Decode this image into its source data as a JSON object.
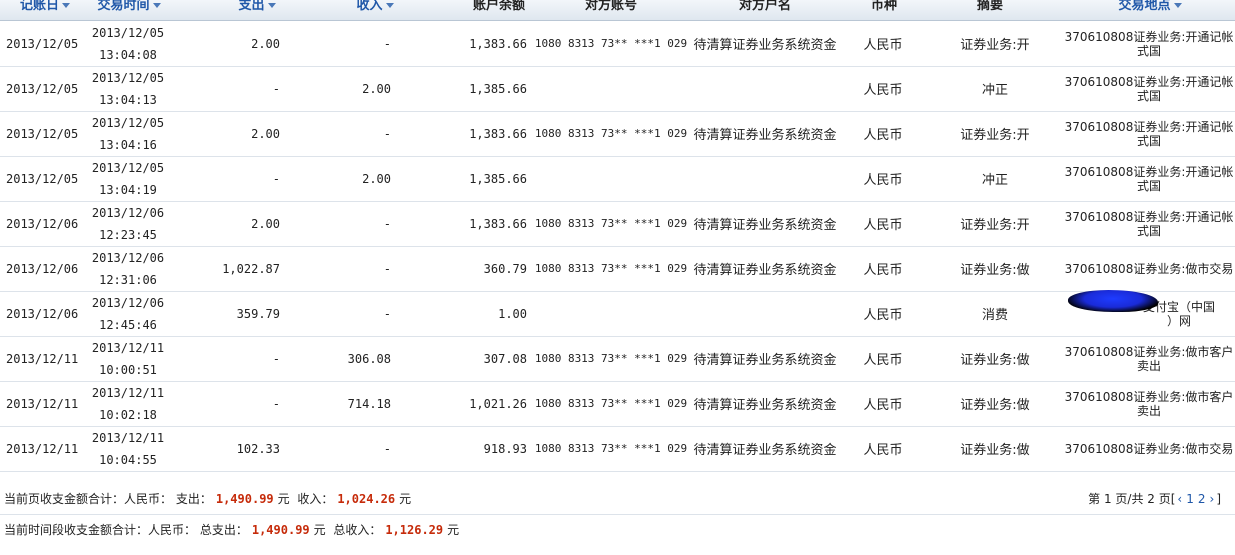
{
  "headers": {
    "record_date": "记账日",
    "trade_time": "交易时间",
    "expense": "支出",
    "income": "收入",
    "balance": "账户余额",
    "counter_account": "对方账号",
    "counter_name": "对方户名",
    "currency": "币种",
    "summary": "摘要",
    "location": "交易地点"
  },
  "rows": [
    {
      "date": "2013/12/05",
      "time_date": "2013/12/05",
      "time_clock": "13:04:08",
      "expense": "2.00",
      "income": "-",
      "balance": "1,383.66",
      "account": "1080 8313 73** ***1 029",
      "name": "待清算证券业务系统资金",
      "currency": "人民币",
      "summary": "证券业务:开",
      "loc1": "370610808证券业务:开通记帐",
      "loc2": "式国"
    },
    {
      "date": "2013/12/05",
      "time_date": "2013/12/05",
      "time_clock": "13:04:13",
      "expense": "-",
      "income": "2.00",
      "balance": "1,385.66",
      "account": "",
      "name": "",
      "currency": "人民币",
      "summary": "冲正",
      "loc1": "370610808证券业务:开通记帐",
      "loc2": "式国"
    },
    {
      "date": "2013/12/05",
      "time_date": "2013/12/05",
      "time_clock": "13:04:16",
      "expense": "2.00",
      "income": "-",
      "balance": "1,383.66",
      "account": "1080 8313 73** ***1 029",
      "name": "待清算证券业务系统资金",
      "currency": "人民币",
      "summary": "证券业务:开",
      "loc1": "370610808证券业务:开通记帐",
      "loc2": "式国"
    },
    {
      "date": "2013/12/05",
      "time_date": "2013/12/05",
      "time_clock": "13:04:19",
      "expense": "-",
      "income": "2.00",
      "balance": "1,385.66",
      "account": "",
      "name": "",
      "currency": "人民币",
      "summary": "冲正",
      "loc1": "370610808证券业务:开通记帐",
      "loc2": "式国"
    },
    {
      "date": "2013/12/06",
      "time_date": "2013/12/06",
      "time_clock": "12:23:45",
      "expense": "2.00",
      "income": "-",
      "balance": "1,383.66",
      "account": "1080 8313 73** ***1 029",
      "name": "待清算证券业务系统资金",
      "currency": "人民币",
      "summary": "证券业务:开",
      "loc1": "370610808证券业务:开通记帐",
      "loc2": "式国"
    },
    {
      "date": "2013/12/06",
      "time_date": "2013/12/06",
      "time_clock": "12:31:06",
      "expense": "1,022.87",
      "income": "-",
      "balance": "360.79",
      "account": "1080 8313 73** ***1 029",
      "name": "待清算证券业务系统资金",
      "currency": "人民币",
      "summary": "证券业务:做",
      "loc1": "370610808证券业务:做市交易",
      "loc2": ""
    },
    {
      "date": "2013/12/06",
      "time_date": "2013/12/06",
      "time_clock": "12:45:46",
      "expense": "359.79",
      "income": "-",
      "balance": "1.00",
      "account": "",
      "name": "",
      "currency": "人民币",
      "summary": "消费",
      "loc1": "支付宝（中国",
      "loc2": "）网"
    },
    {
      "date": "2013/12/11",
      "time_date": "2013/12/11",
      "time_clock": "10:00:51",
      "expense": "-",
      "income": "306.08",
      "balance": "307.08",
      "account": "1080 8313 73** ***1 029",
      "name": "待清算证券业务系统资金",
      "currency": "人民币",
      "summary": "证券业务:做",
      "loc1": "370610808证券业务:做市客户",
      "loc2": "卖出"
    },
    {
      "date": "2013/12/11",
      "time_date": "2013/12/11",
      "time_clock": "10:02:18",
      "expense": "-",
      "income": "714.18",
      "balance": "1,021.26",
      "account": "1080 8313 73** ***1 029",
      "name": "待清算证券业务系统资金",
      "currency": "人民币",
      "summary": "证券业务:做",
      "loc1": "370610808证券业务:做市客户",
      "loc2": "卖出"
    },
    {
      "date": "2013/12/11",
      "time_date": "2013/12/11",
      "time_clock": "10:04:55",
      "expense": "102.33",
      "income": "-",
      "balance": "918.93",
      "account": "1080 8313 73** ***1 029",
      "name": "待清算证券业务系统资金",
      "currency": "人民币",
      "summary": "证券业务:做",
      "loc1": "370610808证券业务:做市交易",
      "loc2": ""
    }
  ],
  "page_summary": {
    "label": "当前页收支金额合计：人民币：",
    "expense_label": "支出：",
    "expense_value": "1,490.99",
    "unit": "元",
    "income_label": "收入：",
    "income_value": "1,024.26"
  },
  "period_summary": {
    "label": "当前时间段收支金额合计：人民币：",
    "expense_label": "总支出：",
    "expense_value": "1,490.99",
    "unit": "元",
    "income_label": "总收入：",
    "income_value": "1,126.29"
  },
  "pager": {
    "text_before": "第 1 页/共 2 页[",
    "prev": "‹",
    "page1": "1",
    "page2": "2",
    "next": "›",
    "text_after": "]"
  },
  "colors": {
    "header_link": "#1f57a8",
    "amount_red": "#c62b0a",
    "redaction": "#1a2bd8"
  }
}
